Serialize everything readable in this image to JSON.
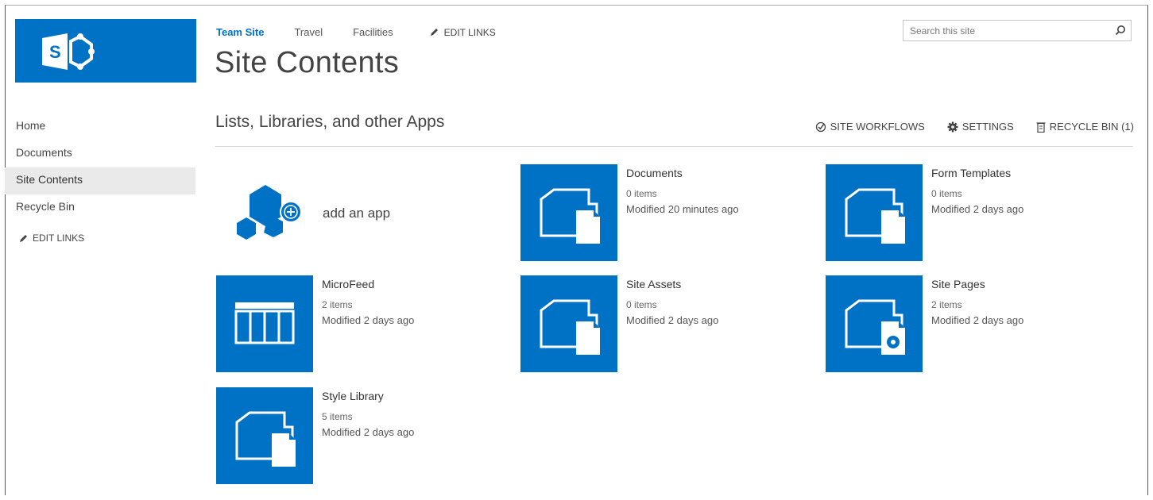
{
  "nav_top": {
    "links": [
      "Team Site",
      "Travel",
      "Facilities"
    ],
    "edit_links": "EDIT LINKS"
  },
  "page_title": "Site Contents",
  "search": {
    "placeholder": "Search this site"
  },
  "left_nav": {
    "items": [
      {
        "label": "Home",
        "selected": false
      },
      {
        "label": "Documents",
        "selected": false
      },
      {
        "label": "Site Contents",
        "selected": true
      },
      {
        "label": "Recycle Bin",
        "selected": false
      }
    ],
    "edit_links": "EDIT LINKS"
  },
  "section": {
    "title": "Lists, Libraries, and other Apps",
    "actions": {
      "workflows": "SITE WORKFLOWS",
      "settings": "SETTINGS",
      "recycle": "RECYCLE BIN (1)"
    }
  },
  "add_app": {
    "label": "add an app"
  },
  "apps": [
    {
      "name": "Documents",
      "count": "0 items",
      "modified": "Modified 20 minutes ago",
      "icon": "document-library-icon"
    },
    {
      "name": "Form Templates",
      "count": "0 items",
      "modified": "Modified 2 days ago",
      "icon": "document-library-icon"
    },
    {
      "name": "MicroFeed",
      "count": "2 items",
      "modified": "Modified 2 days ago",
      "icon": "list-icon"
    },
    {
      "name": "Site Assets",
      "count": "0 items",
      "modified": "Modified 2 days ago",
      "icon": "document-library-icon"
    },
    {
      "name": "Site Pages",
      "count": "2 items",
      "modified": "Modified 2 days ago",
      "icon": "wiki-library-icon"
    },
    {
      "name": "Style Library",
      "count": "5 items",
      "modified": "Modified 2 days ago",
      "icon": "document-library-icon"
    }
  ],
  "colors": {
    "brand": "#0072c6",
    "selected_nav_bg": "#eaeaea"
  }
}
